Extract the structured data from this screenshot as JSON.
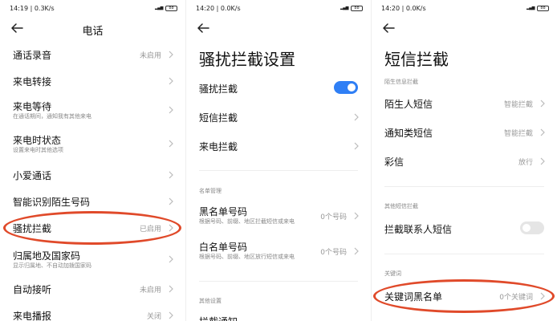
{
  "panel1": {
    "time": "14:19 | 0.3K/s",
    "battery": "88",
    "title": "电话",
    "rows": [
      {
        "label": "通话录音",
        "value": "未启用"
      },
      {
        "label": "来电转接"
      },
      {
        "label": "来电等待",
        "sub": "在通话期间，通知我有其他来电"
      },
      {
        "label": "来电时状态",
        "sub": "设置来电时其他选项"
      },
      {
        "label": "小爱通话"
      },
      {
        "label": "智能识别陌生号码"
      },
      {
        "label": "骚扰拦截",
        "value": "已启用"
      },
      {
        "label": "归属地及国家码",
        "sub": "显示归属地、不自动加拨国家码"
      },
      {
        "label": "自动接听",
        "value": "未启用"
      },
      {
        "label": "来电播报",
        "value": "关闭"
      }
    ]
  },
  "panel2": {
    "time": "14:20 | 0.0K/s",
    "battery": "88",
    "title": "骚扰拦截设置",
    "rows": [
      {
        "label": "骚扰拦截"
      },
      {
        "label": "短信拦截"
      },
      {
        "label": "来电拦截"
      }
    ],
    "section1": "名单管理",
    "rows2": [
      {
        "label": "黑名单号码",
        "sub": "根据号码、前缀、地区拦截短信或来电",
        "value": "0个号码"
      },
      {
        "label": "白名单号码",
        "sub": "根据号码、前缀、地区放行短信或来电",
        "value": "0个号码"
      }
    ],
    "section2": "其他设置",
    "partial_label": "拦截通知"
  },
  "panel3": {
    "time": "14:20 | 0.0K/s",
    "battery": "88",
    "title": "短信拦截",
    "section1": "陌生信息拦截",
    "rows": [
      {
        "label": "陌生人短信",
        "value": "智能拦截"
      },
      {
        "label": "通知类短信",
        "value": "智能拦截"
      },
      {
        "label": "彩信",
        "value": "放行"
      }
    ],
    "section2": "其他短信拦截",
    "contacts_row": {
      "label": "拦截联系人短信"
    },
    "section3": "关键词",
    "keyword_row": {
      "label": "关键词黑名单",
      "value": "0个关键词"
    }
  },
  "colors": {
    "accent": "#2f7ff5",
    "highlight": "#e04a2a"
  }
}
